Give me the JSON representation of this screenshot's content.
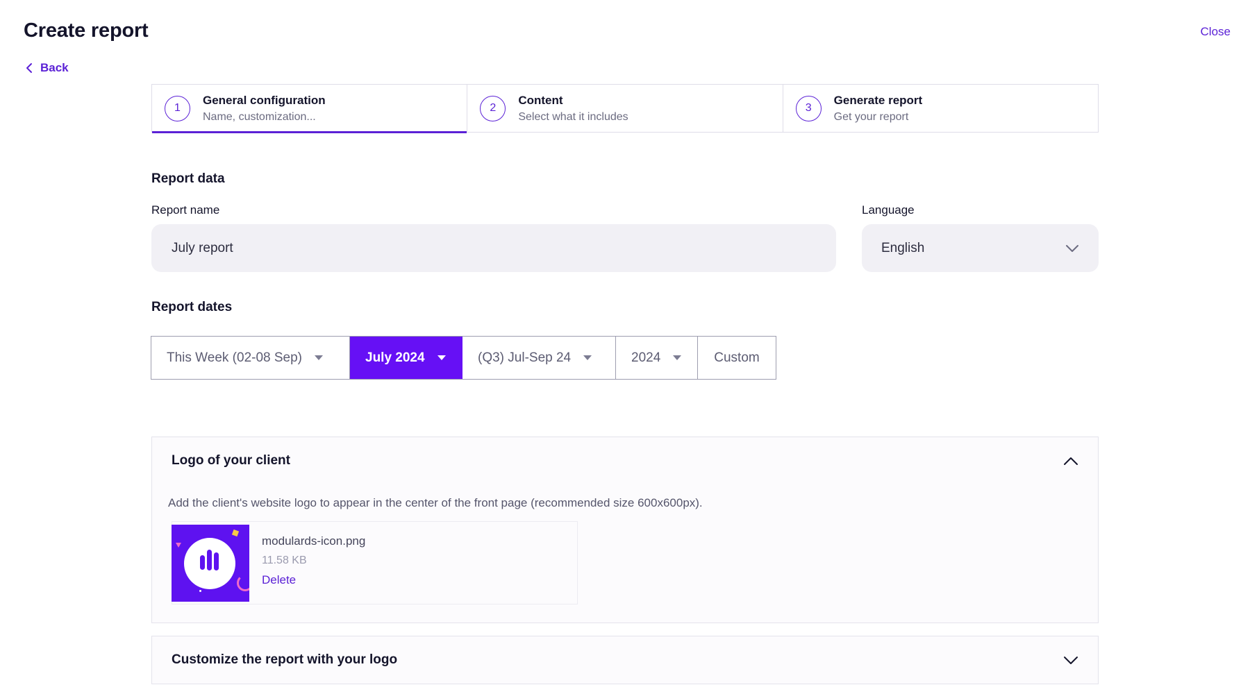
{
  "header": {
    "title": "Create report",
    "close_label": "Close",
    "back_label": "Back"
  },
  "stepper": {
    "steps": [
      {
        "number": "1",
        "title": "General configuration",
        "subtitle": "Name, customization...",
        "active": true
      },
      {
        "number": "2",
        "title": "Content",
        "subtitle": "Select what it includes",
        "active": false
      },
      {
        "number": "3",
        "title": "Generate report",
        "subtitle": "Get your report",
        "active": false
      }
    ]
  },
  "report_data": {
    "heading": "Report data",
    "name_label": "Report name",
    "name_value": "July report",
    "language_label": "Language",
    "language_value": "English"
  },
  "report_dates": {
    "heading": "Report dates",
    "options": [
      {
        "label": "This Week (02-08 Sep)",
        "has_dropdown": true,
        "selected": false
      },
      {
        "label": "July 2024",
        "has_dropdown": true,
        "selected": true
      },
      {
        "label": "(Q3) Jul-Sep 24",
        "has_dropdown": true,
        "selected": false
      },
      {
        "label": "2024",
        "has_dropdown": true,
        "selected": false
      },
      {
        "label": "Custom",
        "has_dropdown": false,
        "selected": false
      }
    ]
  },
  "logo_panel": {
    "title": "Logo of your client",
    "expanded": true,
    "description": "Add the client's website logo to appear in the center of the front page (recommended size 600x600px).",
    "file": {
      "name": "modulards-icon.png",
      "size": "11.58 KB",
      "delete_label": "Delete"
    }
  },
  "customize_panel": {
    "title": "Customize the report with your logo",
    "expanded": false
  },
  "colors": {
    "accent": "#5b21d6",
    "selected_segment": "#6610f5",
    "input_bg": "#f1f0f5"
  }
}
